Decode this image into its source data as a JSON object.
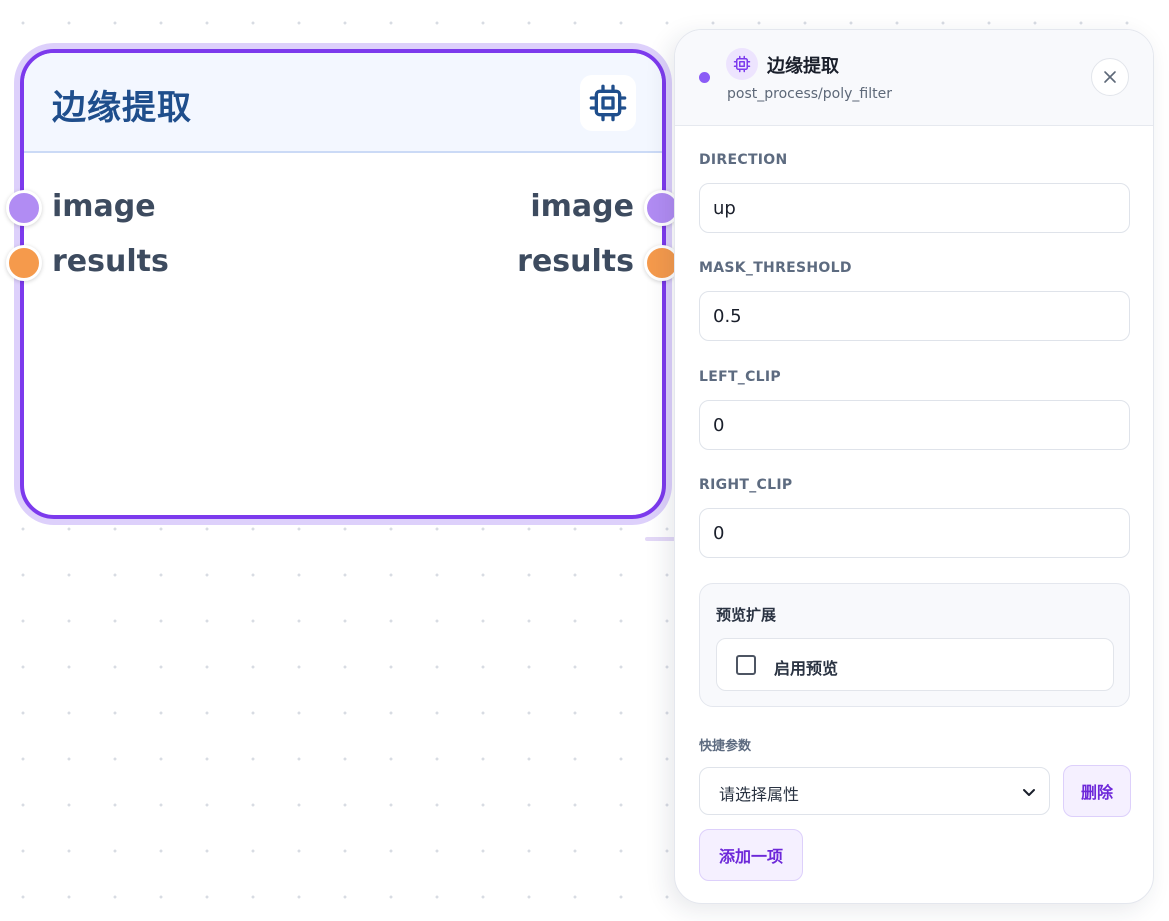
{
  "node": {
    "title": "边缘提取",
    "icon": "cpu-chip-icon",
    "inputs": [
      {
        "label": "image",
        "color": "#b18cf3"
      },
      {
        "label": "results",
        "color": "#f59a4c"
      }
    ],
    "outputs": [
      {
        "label": "image",
        "color": "#b18cf3"
      },
      {
        "label": "results",
        "color": "#f59a4c"
      }
    ],
    "accent": "#7c3aed"
  },
  "panel": {
    "title": "边缘提取",
    "subtitle": "post_process/poly_filter",
    "status_color": "#8b5cf6",
    "close_icon": "close-icon",
    "fields": [
      {
        "label": "DIRECTION",
        "value": "up"
      },
      {
        "label": "MASK_THRESHOLD",
        "value": "0.5"
      },
      {
        "label": "LEFT_CLIP",
        "value": "0"
      },
      {
        "label": "RIGHT_CLIP",
        "value": "0"
      }
    ],
    "preview": {
      "title": "预览扩展",
      "checkbox_label": "启用预览",
      "checked": false
    },
    "quick_params": {
      "label": "快捷参数",
      "select_placeholder": "请选择属性",
      "delete_label": "删除",
      "add_label": "添加一项"
    }
  }
}
